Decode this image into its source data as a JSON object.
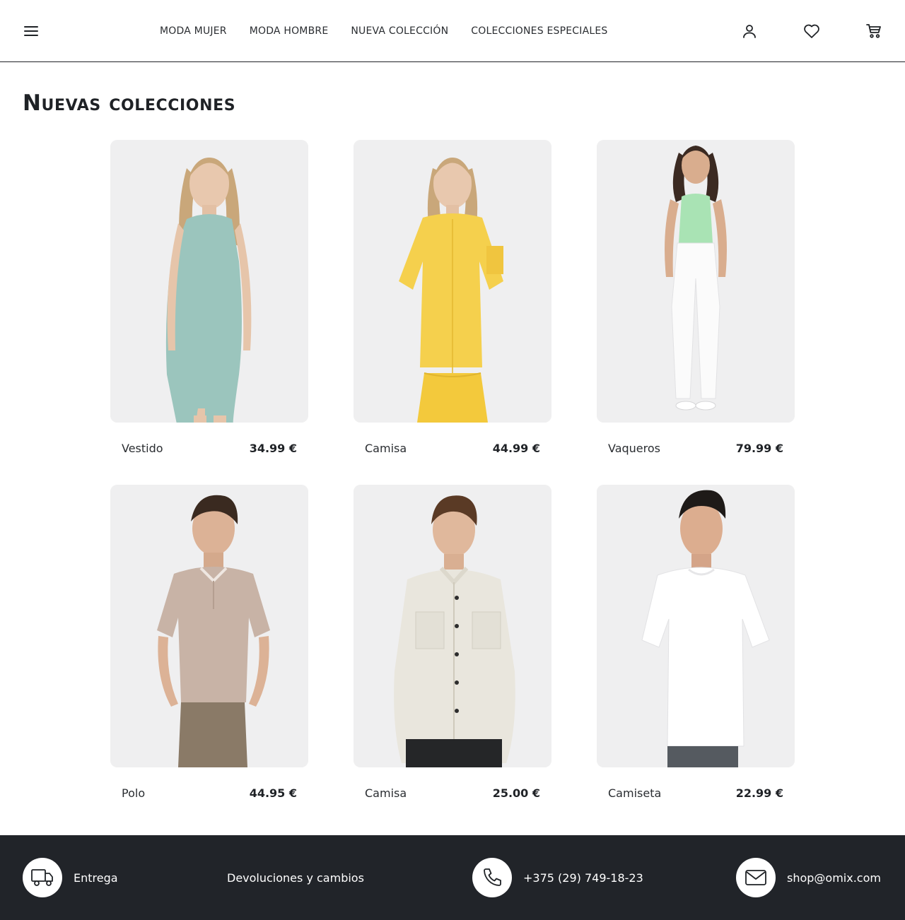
{
  "header": {
    "menu_icon": "hamburger-menu-icon",
    "nav": [
      {
        "label": "MODA MUJER"
      },
      {
        "label": "MODA HOMBRE"
      },
      {
        "label": "NUEVA COLECCIÓN"
      },
      {
        "label": "COLECCIONES ESPECIALES"
      }
    ],
    "icons": [
      "user-icon",
      "heart-icon",
      "cart-icon"
    ]
  },
  "main": {
    "title": "Nuevas colecciones",
    "products": [
      {
        "name": "Vestido",
        "price": "34.99 €",
        "image": "woman-mint-dress-photo"
      },
      {
        "name": "Camisa",
        "price": "44.99 €",
        "image": "woman-yellow-shirt-photo"
      },
      {
        "name": "Vaqueros",
        "price": "79.99 €",
        "image": "woman-white-jeans-photo"
      },
      {
        "name": "Polo",
        "price": "44.95 €",
        "image": "man-beige-polo-photo"
      },
      {
        "name": "Camisa",
        "price": "25.00 €",
        "image": "man-cream-shirt-photo"
      },
      {
        "name": "Camiseta",
        "price": "22.99 €",
        "image": "man-white-tshirt-photo"
      }
    ]
  },
  "footer": {
    "delivery": {
      "label": "Entrega",
      "icon": "truck-icon"
    },
    "returns": {
      "label": "Devoluciones y cambios"
    },
    "phone": {
      "label": "+375 (29) 749-18-23",
      "icon": "phone-icon"
    },
    "email": {
      "label": "shop@omix.com",
      "icon": "mail-icon"
    }
  },
  "colors": {
    "text": "#1f2226",
    "footer_bg": "#212429",
    "card_bg": "#eeeeef"
  }
}
